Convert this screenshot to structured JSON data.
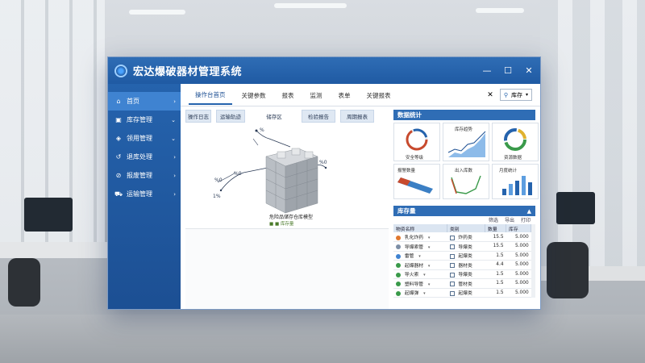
{
  "app": {
    "title": "宏达爆破器材管理系统",
    "window_controls": [
      "—",
      "☐",
      "✕"
    ]
  },
  "sidebar": {
    "items": [
      {
        "label": "首页",
        "icon": "home-icon",
        "arrow": "›"
      },
      {
        "label": "库存管理",
        "icon": "box-icon",
        "arrow": "⌄"
      },
      {
        "label": "领用管理",
        "icon": "handout-icon",
        "arrow": "⌄"
      },
      {
        "label": "退库处理",
        "icon": "return-icon",
        "arrow": "›"
      },
      {
        "label": "报废管理",
        "icon": "scrap-icon",
        "arrow": "›"
      },
      {
        "label": "运输管理",
        "icon": "truck-icon",
        "arrow": "›"
      }
    ]
  },
  "tabbar": {
    "tabs": [
      "操作台首页",
      "关键参数",
      "报表",
      "监测",
      "表单",
      "关键报表"
    ],
    "close_symbol": "✕",
    "search_label": "库存"
  },
  "subtabs": [
    "操作日志",
    "运输轨迹",
    "储存区",
    "检验报告",
    "周期报表"
  ],
  "diagram": {
    "labels": {
      "top": "%",
      "mid": "%0",
      "left": "%0",
      "right": "%0",
      "bottom_left": "1%"
    },
    "caption": "危险品储存仓库模型",
    "legend_text": "■ ■ 库存量"
  },
  "stats": {
    "title": "数据统计",
    "cards": [
      {
        "label": "安全等级",
        "color": "#c84a2d"
      },
      {
        "label": "库存趋势",
        "color": "#2563ad"
      },
      {
        "label": "资源数据",
        "color": "#3a9a4a"
      },
      {
        "label": "报警数量",
        "color": "#3b7fc4"
      },
      {
        "label": "出入库数",
        "color": "#3a9a4a"
      },
      {
        "label": "月度统计",
        "color": "#2563ad"
      }
    ]
  },
  "inventory": {
    "title": "库存量",
    "collapse": "▲",
    "tools": [
      "筛选",
      "导出",
      "打印"
    ],
    "columns": [
      "物资名称",
      "类别",
      "数量",
      "库存"
    ],
    "rows": [
      {
        "name": "乳化炸药",
        "icon_color": "#e0782f",
        "category": "炸药类",
        "qty": "15.5",
        "stock": "5.000"
      },
      {
        "name": "导爆索管",
        "icon_color": "#7d8fa6",
        "category": "导爆类",
        "qty": "15.5",
        "stock": "5.000"
      },
      {
        "name": "雷管",
        "icon_color": "#3f83d1",
        "category": "起爆类",
        "qty": "1.5",
        "stock": "5.000"
      },
      {
        "name": "起爆器材",
        "icon_color": "#3a9a4a",
        "category": "器材类",
        "qty": "4.4",
        "stock": "5.000"
      },
      {
        "name": "导火索",
        "icon_color": "#3a9a4a",
        "category": "导爆类",
        "qty": "1.5",
        "stock": "5.000"
      },
      {
        "name": "塑料导管",
        "icon_color": "#3a9a4a",
        "category": "管材类",
        "qty": "1.5",
        "stock": "5.000"
      },
      {
        "name": "起爆弹",
        "icon_color": "#3a9a4a",
        "category": "起爆类",
        "qty": "1.5",
        "stock": "5.000"
      }
    ]
  }
}
